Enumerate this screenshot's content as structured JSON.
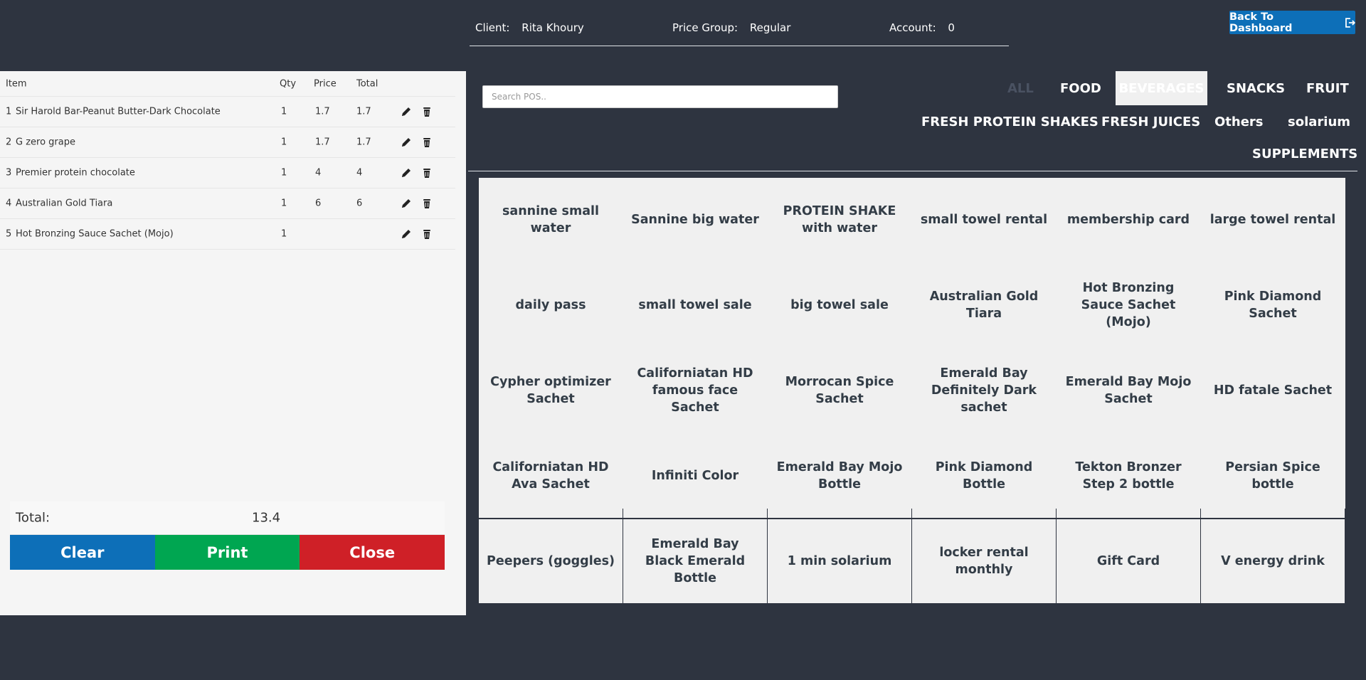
{
  "header": {
    "client_label": "Client:",
    "client_value": "Rita Khoury",
    "price_group_label": "Price Group:",
    "price_group_value": "Regular",
    "account_label": "Account:",
    "account_value": "0",
    "back_button": "Back To Dashboard",
    "back_icon": "exit-icon"
  },
  "cart": {
    "columns": [
      "Item",
      "Qty",
      "Price",
      "Total"
    ],
    "rows": [
      {
        "no": "1",
        "name": "Sir Harold Bar-Peanut Butter-Dark Chocolate",
        "qty": "1",
        "price": "1.7",
        "total": "1.7"
      },
      {
        "no": "2",
        "name": "G zero grape",
        "qty": "1",
        "price": "1.7",
        "total": "1.7"
      },
      {
        "no": "3",
        "name": "Premier protein chocolate",
        "qty": "1",
        "price": "4",
        "total": "4"
      },
      {
        "no": "4",
        "name": "Australian Gold Tiara",
        "qty": "1",
        "price": "6",
        "total": "6"
      },
      {
        "no": "5",
        "name": "Hot Bronzing Sauce Sachet (Mojo)",
        "qty": "1",
        "price": "",
        "total": ""
      }
    ],
    "total_label": "Total:",
    "total_value": "13.4",
    "clear_label": "Clear",
    "print_label": "Print",
    "close_label": "Close"
  },
  "search": {
    "placeholder": "Search POS.."
  },
  "categories": [
    "ALL",
    "FOOD",
    "BEVERAGES",
    "SNACKS",
    "FRUIT",
    "FRESH PROTEIN SHAKES",
    "FRESH JUICES",
    "Others",
    "solarium",
    "SUPPLEMENTS"
  ],
  "active_category": "BEVERAGES",
  "products": [
    "sannine small water",
    "Sannine big water",
    "PROTEIN SHAKE with water",
    "small towel rental",
    "membership card",
    "large towel rental",
    "daily pass",
    "small towel sale",
    "big towel sale",
    "Australian Gold Tiara",
    "Hot Bronzing Sauce Sachet (Mojo)",
    "Pink Diamond Sachet",
    "Cypher optimizer Sachet",
    "Californiatan HD famous face Sachet",
    "Morrocan Spice Sachet",
    "Emerald Bay Definitely Dark sachet",
    "Emerald Bay Mojo Sachet",
    "HD fatale Sachet",
    "Californiatan HD Ava Sachet",
    "Infiniti Color",
    "Emerald Bay Mojo Bottle",
    "Pink Diamond Bottle",
    "Tekton Bronzer Step 2 bottle",
    "Persian Spice bottle",
    "Peepers (goggles)",
    "Emerald Bay Black Emerald Bottle",
    "1 min solarium",
    "locker rental monthly",
    "Gift Card",
    "V energy drink"
  ],
  "colors": {
    "background": "#2e3440",
    "clear": "#0d6fb8",
    "print": "#00a651",
    "close": "#cf2027",
    "tile": "#f0f0f0"
  }
}
